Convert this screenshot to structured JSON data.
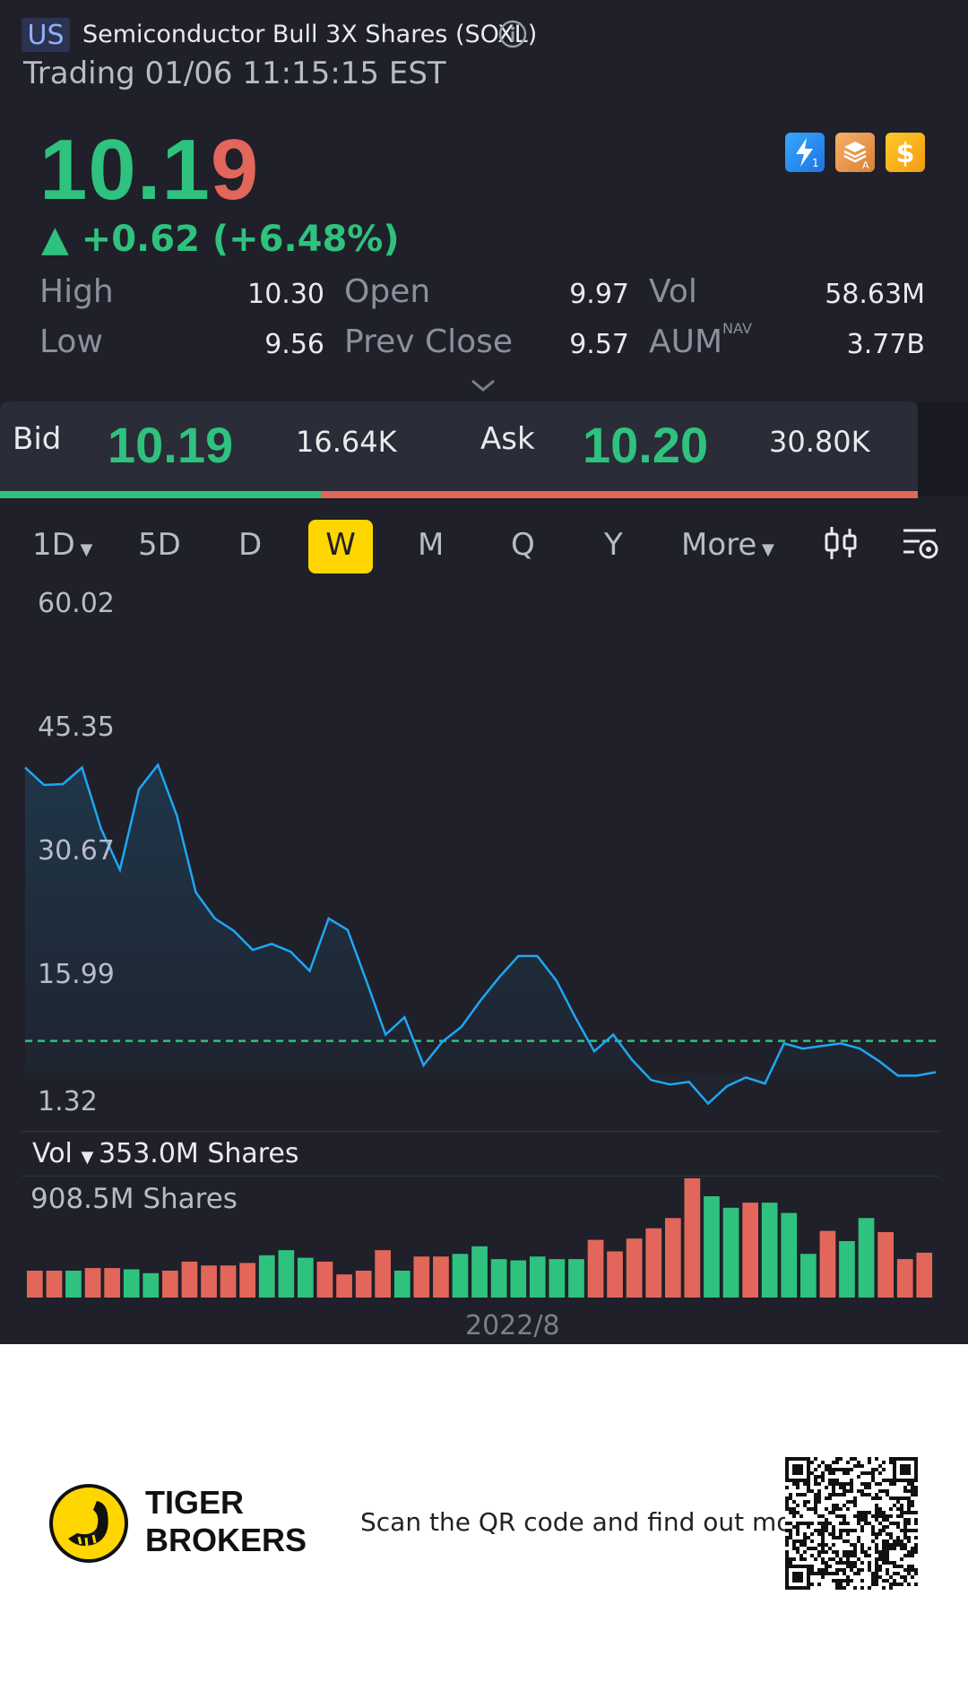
{
  "header": {
    "market": "US",
    "title": "Semiconductor Bull 3X Shares (SOXL)",
    "trade_status": "Trading 01/06 11:15:15 EST"
  },
  "quote": {
    "price_int": "10.1",
    "price_last": "9",
    "change": "▲ +0.62 (+6.48%)",
    "up_color": "#2ec27e",
    "down_color": "#e2675a"
  },
  "stats": {
    "high_label": "High",
    "high": "10.30",
    "low_label": "Low",
    "low": "9.56",
    "open_label": "Open",
    "open": "9.97",
    "prev_close_label": "Prev Close",
    "prev_close": "9.57",
    "vol_label": "Vol",
    "vol": "58.63M",
    "aum_label": "AUM",
    "aum_sup": "NAV",
    "aum": "3.77B"
  },
  "bidask": {
    "bid_label": "Bid",
    "bid_price": "10.19",
    "bid_size": "16.64K",
    "ask_label": "Ask",
    "ask_price": "10.20",
    "ask_size": "30.80K",
    "bid_share": 0.35
  },
  "tabs": {
    "t_1d": "1D",
    "t_5d": "5D",
    "t_d": "D",
    "t_w": "W",
    "t_m": "M",
    "t_q": "Q",
    "t_y": "Y",
    "t_more": "More",
    "active": "W"
  },
  "chart": {
    "y_ticks": [
      "60.02",
      "45.35",
      "30.67",
      "15.99",
      "1.32"
    ],
    "vol_label": "Vol",
    "vol_value": "353.0M Shares",
    "vol_max_label": "908.5M Shares",
    "x_label": "2022/8"
  },
  "chart_data": {
    "type": "line",
    "ylim": [
      1.32,
      60.02
    ],
    "current_price_line": 10.19,
    "line_color": "#1ea7f5",
    "price_series": [
      41.5,
      39.5,
      39.6,
      41.5,
      34.5,
      29.8,
      39.0,
      41.8,
      36.0,
      27.2,
      24.2,
      22.8,
      20.6,
      21.3,
      20.4,
      18.2,
      24.2,
      22.9,
      17.0,
      10.9,
      12.9,
      7.4,
      10.1,
      11.8,
      14.8,
      17.5,
      19.9,
      19.9,
      17.1,
      12.9,
      9.0,
      10.9,
      8.0,
      5.7,
      5.2,
      5.5,
      3.0,
      5.0,
      6.0,
      5.3,
      9.9,
      9.3,
      9.6,
      9.9,
      9.3,
      7.9,
      6.2,
      6.2,
      6.6
    ],
    "volume_max": 908.5,
    "volume_colors": [
      "down",
      "down",
      "up",
      "down",
      "down",
      "up",
      "up",
      "down",
      "down",
      "down",
      "down",
      "down",
      "up",
      "up",
      "up",
      "down",
      "down",
      "down",
      "down",
      "up",
      "down",
      "down",
      "up",
      "up",
      "up",
      "up",
      "up",
      "up",
      "up",
      "down",
      "down",
      "down",
      "down",
      "down",
      "down",
      "up",
      "up",
      "down",
      "up",
      "up",
      "up",
      "down",
      "up",
      "up",
      "down",
      "down",
      "down",
      "down",
      "up"
    ],
    "volume_series": [
      210,
      210,
      210,
      230,
      230,
      220,
      190,
      210,
      280,
      250,
      250,
      270,
      330,
      370,
      310,
      280,
      180,
      210,
      370,
      210,
      320,
      320,
      340,
      400,
      300,
      290,
      320,
      300,
      300,
      450,
      360,
      460,
      540,
      620,
      930,
      790,
      700,
      740,
      740,
      660,
      340,
      520,
      440,
      620,
      510,
      300,
      350
    ]
  },
  "footer": {
    "brand_line1": "TIGER",
    "brand_line2": "BROKERS",
    "scan_text": "Scan the QR code and find out more"
  }
}
